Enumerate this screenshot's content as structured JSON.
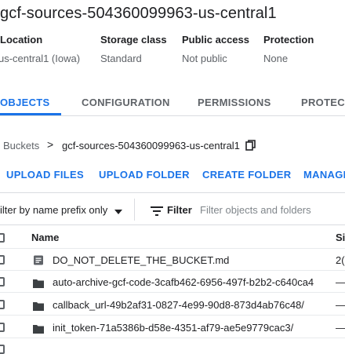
{
  "title": "gcf-sources-504360099963-us-central1",
  "info": {
    "headers": [
      "Location",
      "Storage class",
      "Public access",
      "Protection"
    ],
    "values": [
      "us-central1 (Iowa)",
      "Standard",
      "Not public",
      "None"
    ]
  },
  "tabs": [
    {
      "label": "OBJECTS",
      "active": true
    },
    {
      "label": "CONFIGURATION",
      "active": false
    },
    {
      "label": "PERMISSIONS",
      "active": false
    },
    {
      "label": "PROTECT",
      "active": false
    }
  ],
  "breadcrumb": {
    "root": "Buckets",
    "separator": ">",
    "current": "gcf-sources-504360099963-us-central1"
  },
  "actions": [
    "UPLOAD FILES",
    "UPLOAD FOLDER",
    "CREATE FOLDER",
    "MANAGE"
  ],
  "filter": {
    "prefix_select": "ilter by name prefix only",
    "label": "Filter",
    "placeholder": "Filter objects and folders"
  },
  "table": {
    "headers": {
      "name": "Name",
      "size": "Si"
    },
    "rows": [
      {
        "icon": "document-icon",
        "name": "DO_NOT_DELETE_THE_BUCKET.md",
        "size": "2("
      },
      {
        "icon": "folder-icon",
        "name": "auto-archive-gcf-code-3cafb462-6956-497f-b2b2-c640ca4",
        "size": "—"
      },
      {
        "icon": "folder-icon",
        "name": "callback_url-49b2af31-0827-4e99-90d8-873d4ab76c48/",
        "size": "—"
      },
      {
        "icon": "folder-icon",
        "name": "init_token-71a5386b-d58e-4351-af79-ae5e9779cac3/",
        "size": "—"
      }
    ]
  },
  "colors": {
    "accent": "#1a73e8",
    "text": "#202124",
    "muted": "#5f6368",
    "divider": "#dadce0"
  }
}
